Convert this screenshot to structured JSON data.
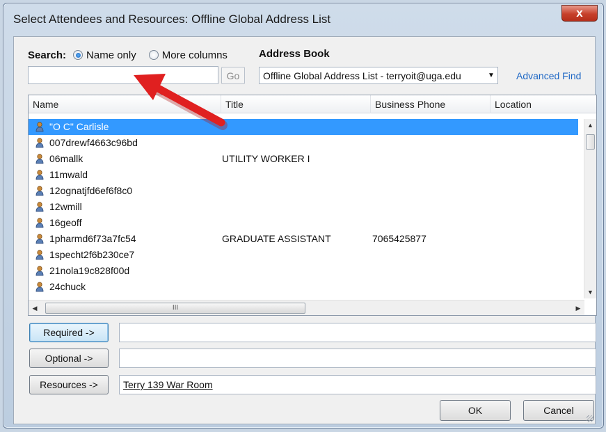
{
  "window": {
    "title": "Select Attendees and Resources: Offline Global Address List",
    "close_label": "x"
  },
  "search": {
    "label": "Search:",
    "options": [
      "Name only",
      "More columns"
    ],
    "selected": "Name only",
    "value": "",
    "placeholder": "",
    "go_label": "Go"
  },
  "address_book": {
    "label": "Address Book",
    "selected": "Offline Global Address List - terryoit@uga.edu",
    "advanced_find": "Advanced Find"
  },
  "list": {
    "columns": [
      "Name",
      "Title",
      "Business Phone",
      "Location"
    ],
    "rows": [
      {
        "name": "\"O C\" Carlisle",
        "title": "",
        "phone": "",
        "selected": true
      },
      {
        "name": "007drewf4663c96bd",
        "title": "",
        "phone": ""
      },
      {
        "name": "06mallk",
        "title": "UTILITY WORKER I",
        "phone": ""
      },
      {
        "name": "11mwald",
        "title": "",
        "phone": ""
      },
      {
        "name": "12ognatjfd6ef6f8c0",
        "title": "",
        "phone": ""
      },
      {
        "name": "12wmill",
        "title": "",
        "phone": ""
      },
      {
        "name": "16geoff",
        "title": "",
        "phone": ""
      },
      {
        "name": "1pharmd6f73a7fc54",
        "title": "GRADUATE ASSISTANT",
        "phone": "7065425877"
      },
      {
        "name": "1specht2f6b230ce7",
        "title": "",
        "phone": ""
      },
      {
        "name": "21nola19c828f00d",
        "title": "",
        "phone": ""
      },
      {
        "name": "24chuck",
        "title": "",
        "phone": ""
      }
    ],
    "hscroll_grip": "III"
  },
  "recipients": {
    "required_label": "Required ->",
    "required_value": "",
    "optional_label": "Optional ->",
    "optional_value": "",
    "resources_label": "Resources ->",
    "resources_value": "Terry 139 War Room"
  },
  "footer": {
    "ok_label": "OK",
    "cancel_label": "Cancel"
  },
  "colors": {
    "selection": "#3399ff",
    "link": "#1c66c4",
    "annotation_arrow": "#e02020"
  }
}
